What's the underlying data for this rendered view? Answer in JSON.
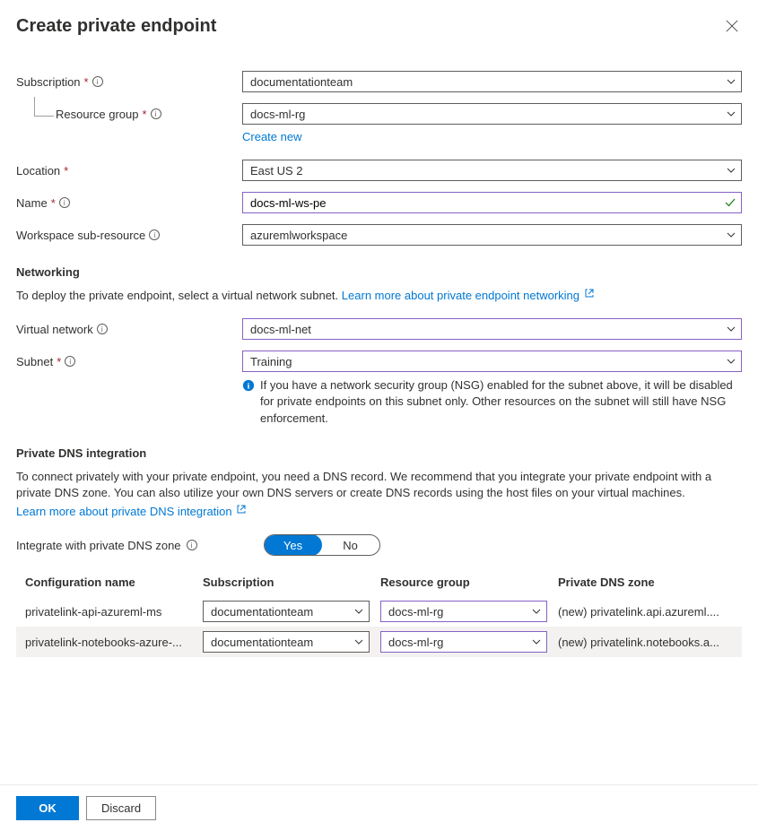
{
  "title": "Create private endpoint",
  "labels": {
    "subscription": "Subscription",
    "resourceGroup": "Resource group",
    "createNew": "Create new",
    "location": "Location",
    "name": "Name",
    "workspaceSubResource": "Workspace sub-resource"
  },
  "values": {
    "subscription": "documentationteam",
    "resourceGroup": "docs-ml-rg",
    "location": "East US 2",
    "name": "docs-ml-ws-pe",
    "workspaceSubResource": "azuremlworkspace"
  },
  "networking": {
    "heading": "Networking",
    "description": "To deploy the private endpoint, select a virtual network subnet.",
    "learnMore": "Learn more about private endpoint networking",
    "virtualNetworkLabel": "Virtual network",
    "virtualNetworkValue": "docs-ml-net",
    "subnetLabel": "Subnet",
    "subnetValue": "Training",
    "nsgInfo": "If you have a network security group (NSG) enabled for the subnet above, it will be disabled for private endpoints on this subnet only. Other resources on the subnet will still have NSG enforcement."
  },
  "dns": {
    "heading": "Private DNS integration",
    "description": "To connect privately with your private endpoint, you need a DNS record. We recommend that you integrate your private endpoint with a private DNS zone. You can also utilize your own DNS servers or create DNS records using the host files on your virtual machines.",
    "learnMore": "Learn more about private DNS integration",
    "toggleLabel": "Integrate with private DNS zone",
    "toggleYes": "Yes",
    "toggleNo": "No"
  },
  "table": {
    "headers": {
      "configName": "Configuration name",
      "subscription": "Subscription",
      "resourceGroup": "Resource group",
      "privateDnsZone": "Private DNS zone"
    },
    "rows": [
      {
        "configName": "privatelink-api-azureml-ms",
        "subscription": "documentationteam",
        "resourceGroup": "docs-ml-rg",
        "dnsZone": "(new) privatelink.api.azureml...."
      },
      {
        "configName": "privatelink-notebooks-azure-...",
        "subscription": "documentationteam",
        "resourceGroup": "docs-ml-rg",
        "dnsZone": "(new) privatelink.notebooks.a..."
      }
    ]
  },
  "buttons": {
    "ok": "OK",
    "discard": "Discard"
  }
}
